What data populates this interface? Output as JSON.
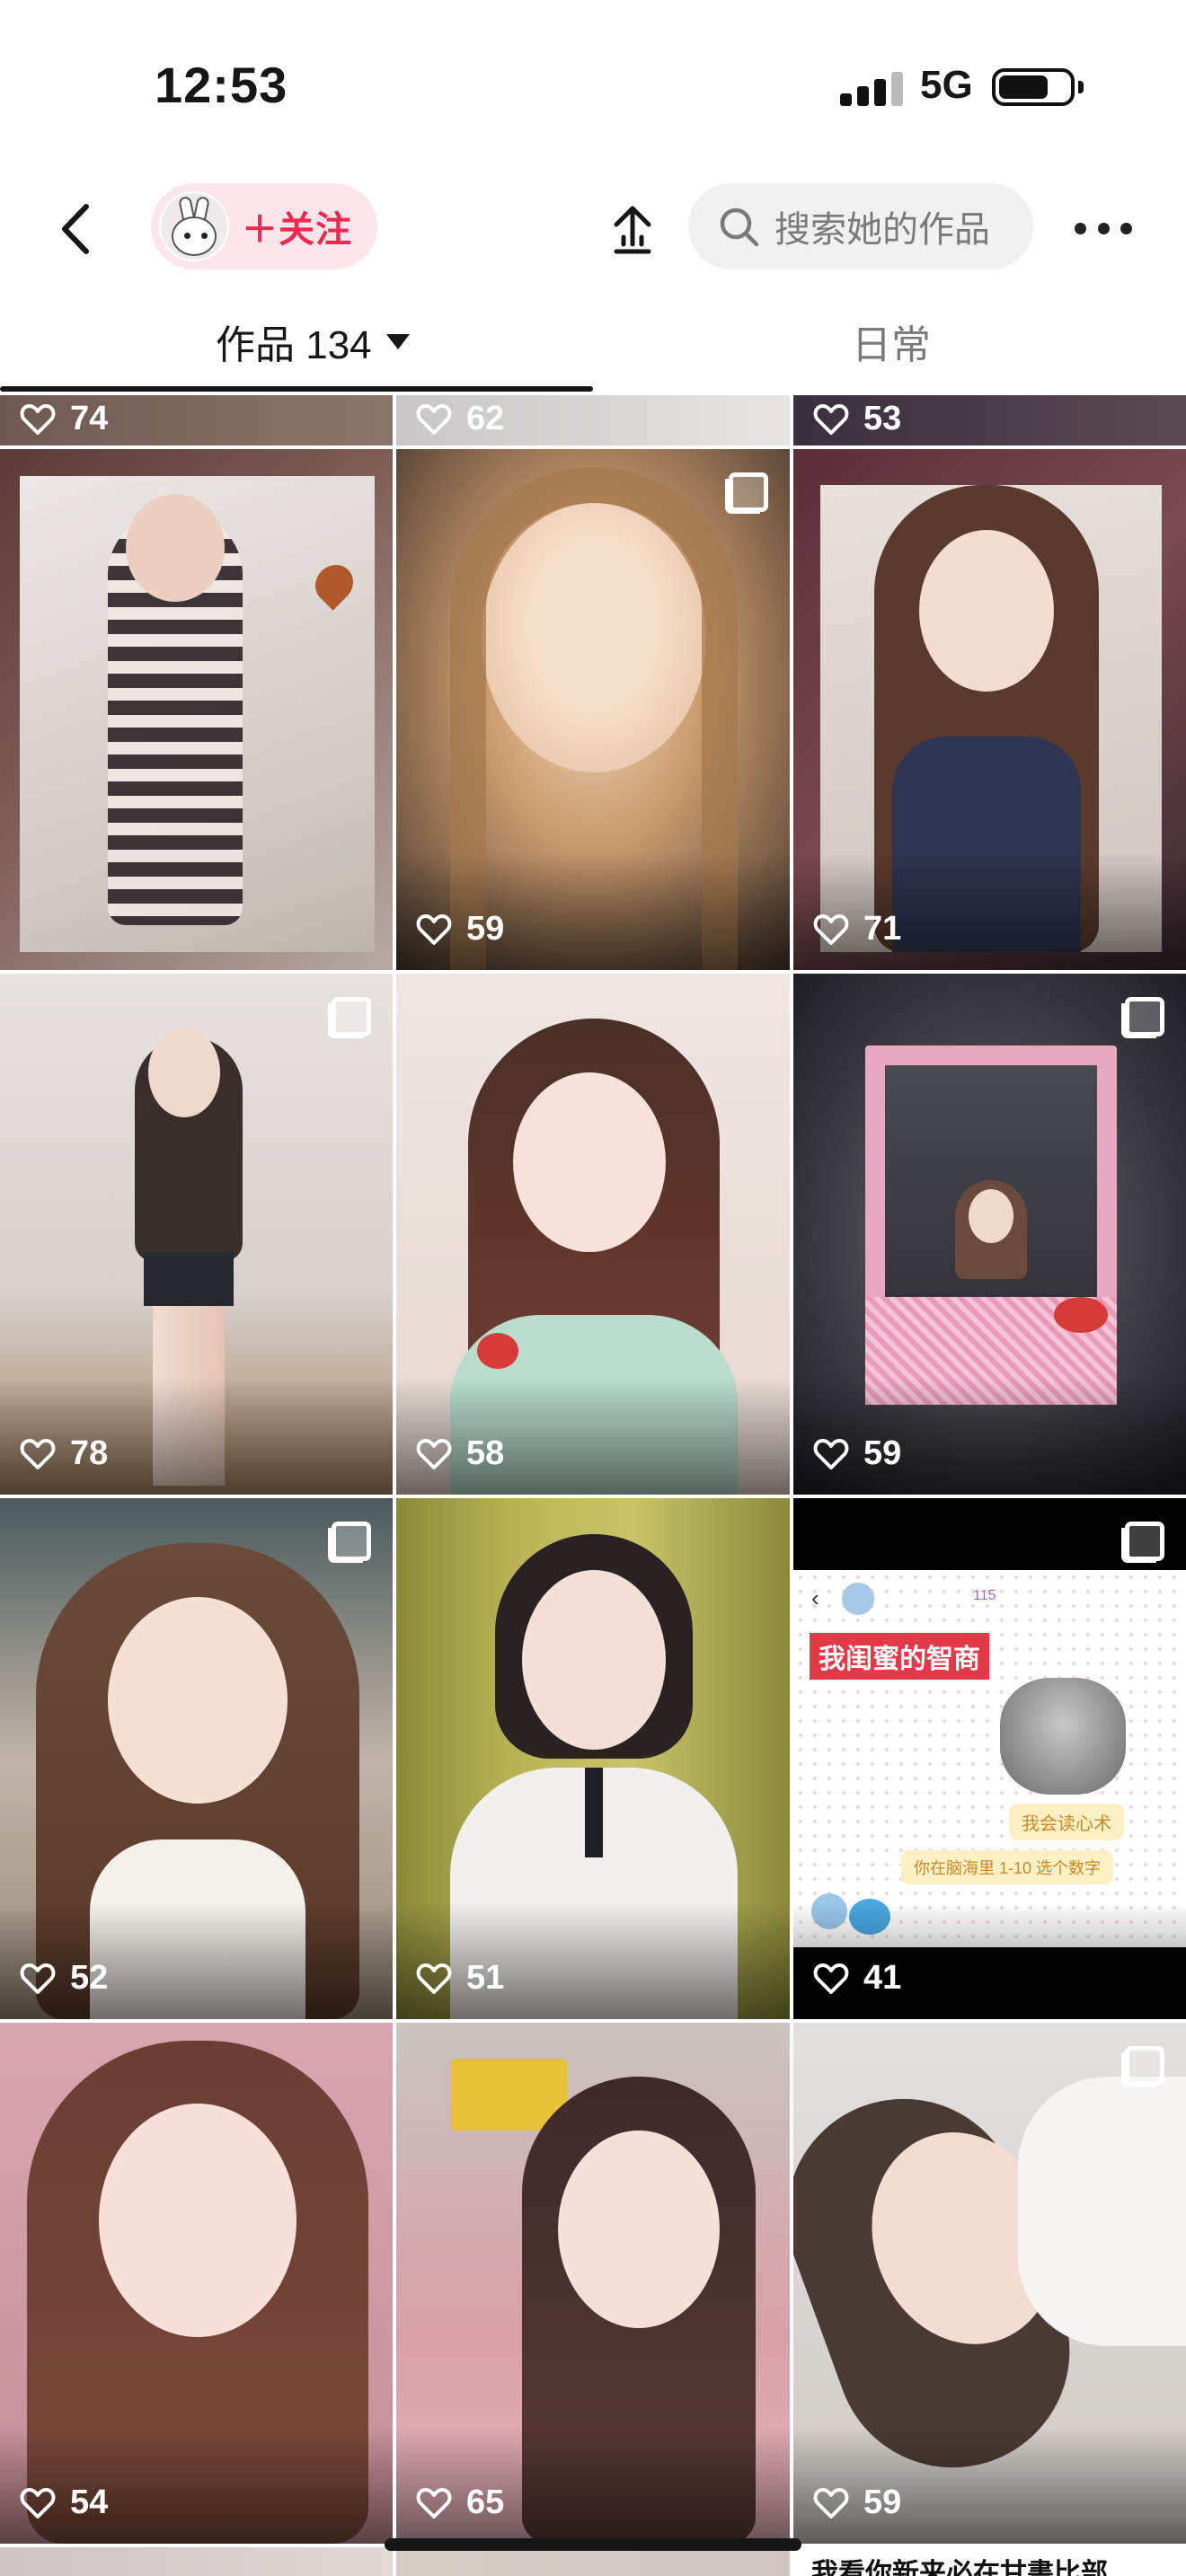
{
  "status_bar": {
    "time": "12:53",
    "network": "5G"
  },
  "header": {
    "follow_label": "＋关注",
    "search_placeholder": "搜索她的作品"
  },
  "tabs": {
    "works_label": "作品 134",
    "daily_label": "日常"
  },
  "grid": {
    "partial_top_likes": [
      "74",
      "62",
      "53"
    ],
    "posts": [
      {
        "likes": "",
        "multi": false
      },
      {
        "likes": "59",
        "multi": true
      },
      {
        "likes": "71",
        "multi": false
      },
      {
        "likes": "78",
        "multi": true
      },
      {
        "likes": "58",
        "multi": false
      },
      {
        "likes": "59",
        "multi": true
      },
      {
        "likes": "52",
        "multi": true
      },
      {
        "likes": "51",
        "multi": false
      },
      {
        "likes": "41",
        "multi": true
      },
      {
        "likes": "54",
        "multi": false
      },
      {
        "likes": "65",
        "multi": false
      },
      {
        "likes": "59",
        "multi": true
      }
    ],
    "chat_post": {
      "title": "我闺蜜的智商",
      "bubble1": "我会读心术",
      "bubble2": "你在脑海里 1-10 选个数字",
      "badge": "115"
    },
    "bottom_partial_text": "我看你新来必在甘書比部"
  },
  "colors": {
    "accent": "#f2294f",
    "follow_bg": "#fde6eb",
    "search_bg": "#f1f1f1"
  }
}
